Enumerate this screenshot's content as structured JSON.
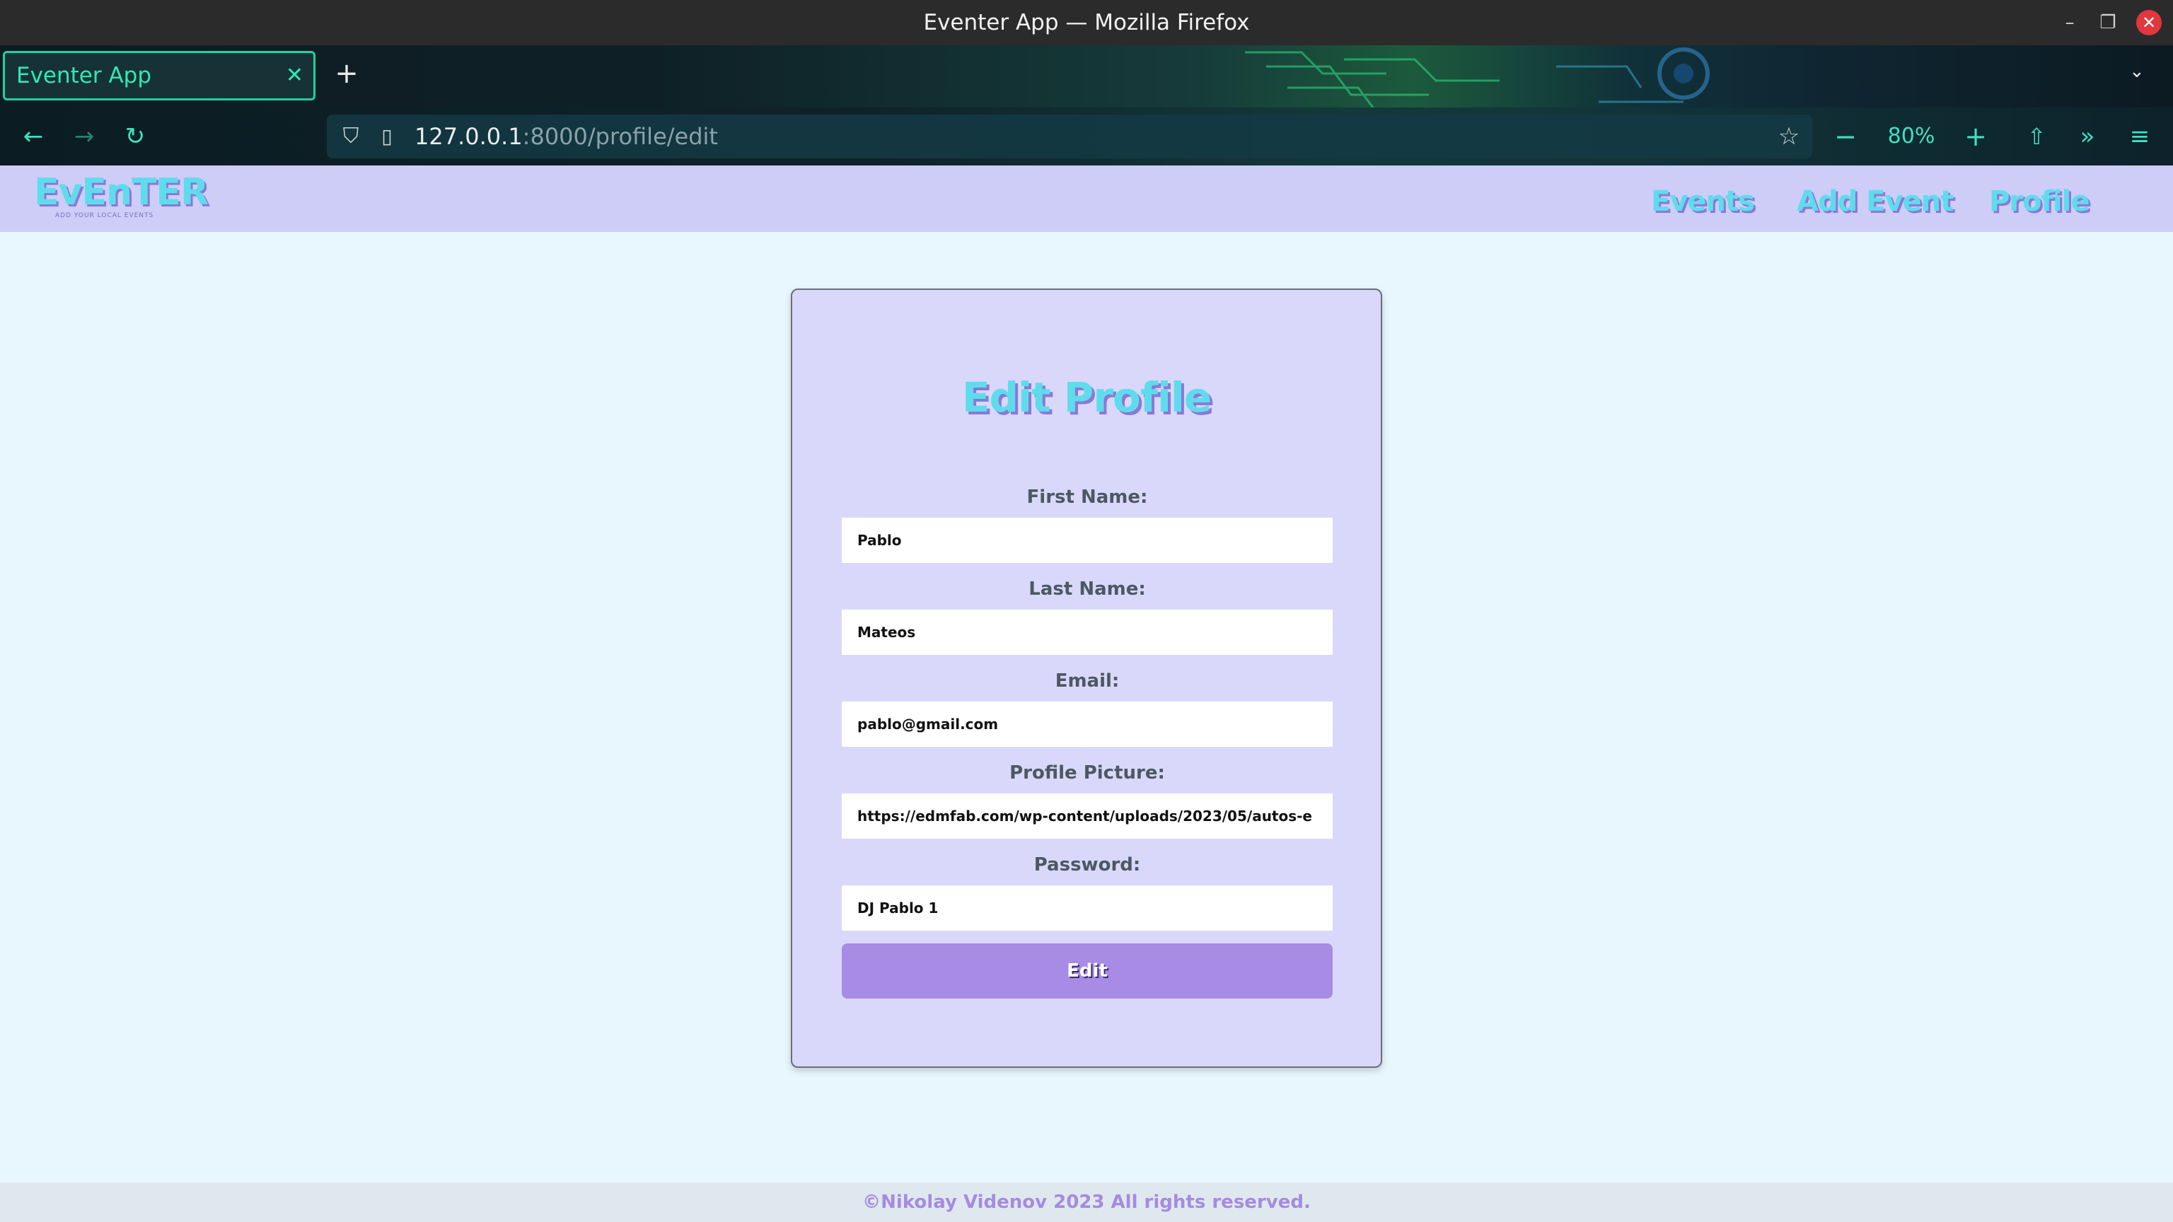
{
  "window": {
    "title": "Eventer App — Mozilla Firefox",
    "minimize": "–",
    "maximize": "❐",
    "close": "✕"
  },
  "tabs": {
    "active_label": "Eventer App",
    "close": "✕",
    "new_tab": "+",
    "list": "⌄"
  },
  "nav": {
    "back": "←",
    "forward": "→",
    "reload": "↻",
    "url_host": "127.0.0.1",
    "url_path": ":8000/profile/edit",
    "zoom_out": "−",
    "zoom_level": "80%",
    "zoom_in": "+",
    "extensions": "⇧",
    "more": "»",
    "menu": "≡"
  },
  "site": {
    "logo": "EvEnTER",
    "logo_tagline": "ADD YOUR LOCAL EVENTS",
    "links": [
      "Events",
      "Add Event",
      "Profile"
    ]
  },
  "form": {
    "title": "Edit Profile",
    "fields": [
      {
        "label": "First Name:",
        "value": "Pablo"
      },
      {
        "label": "Last Name:",
        "value": "Mateos"
      },
      {
        "label": "Email:",
        "value": "pablo@gmail.com"
      },
      {
        "label": "Profile Picture:",
        "value": "https://edmfab.com/wp-content/uploads/2023/05/autos-e"
      },
      {
        "label": "Password:",
        "value": "DJ Pablo 1"
      }
    ],
    "submit": "Edit"
  },
  "footer": {
    "text": "©Nikolay Videnov 2023 All rights reserved."
  },
  "colors": {
    "header_bg": "#cdcdf8",
    "page_bg": "#e8f7fd",
    "card_bg": "#d9d8fb",
    "accent_cyan": "#5fdcec",
    "accent_purple": "#8a78d8",
    "button_bg": "#a78be4",
    "footer_text": "#a58be0"
  }
}
